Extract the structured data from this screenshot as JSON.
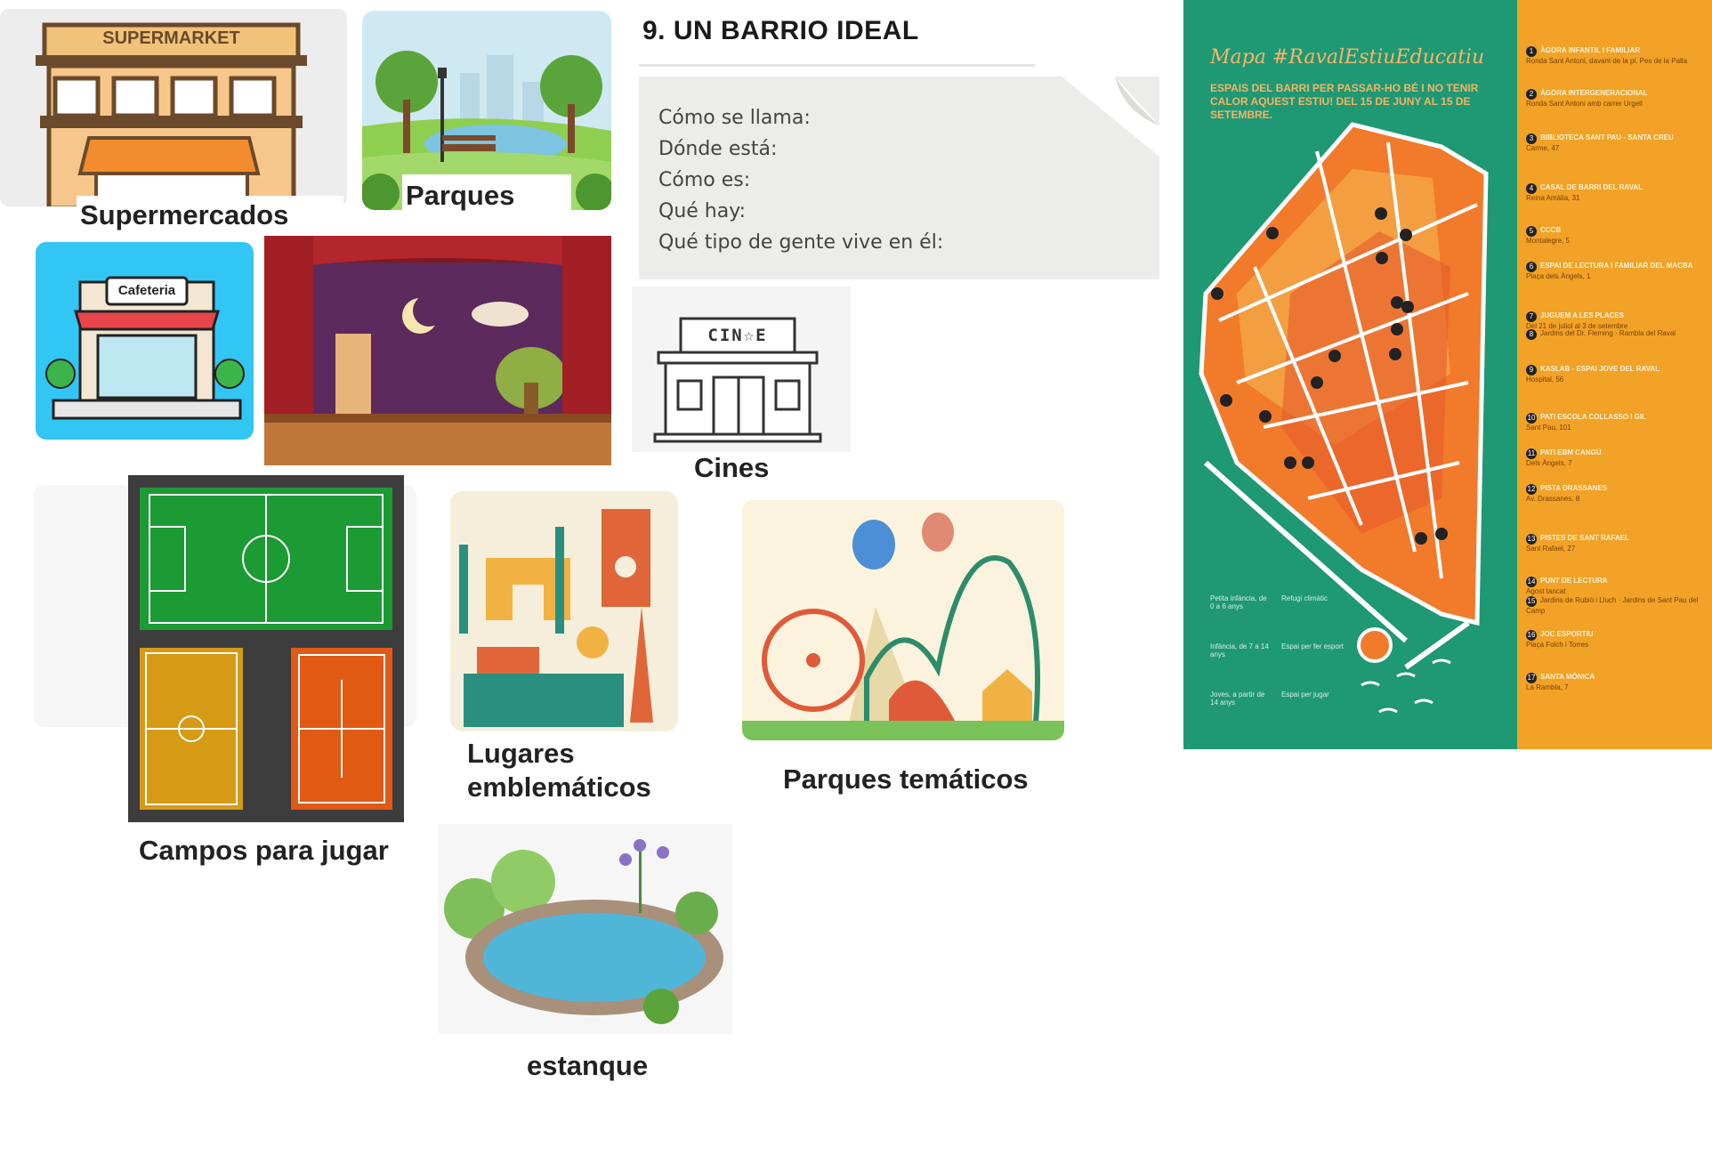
{
  "labels": {
    "supermercados": "Supermercados",
    "parques": "Parques",
    "cines": "Cines",
    "campos": "Campos para jugar",
    "lugares_line1": "Lugares",
    "lugares_line2": "emblemáticos",
    "tematicos": "Parques temáticos",
    "estanque": "estanque"
  },
  "image_text": {
    "supermarket_sign": "SUPERMARKET",
    "cafeteria_sign": "Cafeteria",
    "cinema_sign": "CIN☆E"
  },
  "worksheet": {
    "title": "9. UN BARRIO IDEAL",
    "questions": [
      "Cómo se llama:",
      "Dónde está:",
      "Cómo es:",
      "Qué hay:",
      "Qué tipo de gente vive en él:"
    ]
  },
  "map": {
    "title": "Mapa #RavalEstiuEducatiu",
    "subtitle": "ESPAIS DEL BARRI PER PASSAR-HO BÉ I NO TENIR CALOR AQUEST ESTIU! DEL 15 DE JUNY AL 15 DE SETEMBRE.",
    "legend": [
      {
        "num": "1",
        "name": "ÀGORA INFANTIL I FAMILIAR",
        "detail": "Ronda Sant Antoni, davant de la pl. Pes de la Palla"
      },
      {
        "num": "2",
        "name": "ÀGORA INTERGENERACIONAL",
        "detail": "Ronda Sant Antoni amb carrer Urgell"
      },
      {
        "num": "3",
        "name": "BIBLIOTECA SANT PAU - SANTA CREU",
        "detail": "Carme, 47"
      },
      {
        "num": "4",
        "name": "CASAL DE BARRI DEL RAVAL",
        "detail": "Reina Amàlia, 31"
      },
      {
        "num": "5",
        "name": "CCCB",
        "detail": "Montalegre, 5"
      },
      {
        "num": "6",
        "name": "ESPAI DE LECTURA I FAMILIAR DEL MACBA",
        "detail": "Plaça dels Àngels, 1"
      },
      {
        "num": "7",
        "name": "JUGUEM A LES PLACES",
        "detail": "Del 21 de juliol al 3 de setembre"
      },
      {
        "num": "8",
        "name": "",
        "detail": "Jardins del Dr. Fleming · Rambla del Raval"
      },
      {
        "num": "9",
        "name": "KASLAB - ESPAI JOVE DEL RAVAL",
        "detail": "Hospital, 56"
      },
      {
        "num": "10",
        "name": "PATI ESCOLA COLLASSO I GIL",
        "detail": "Sant Pau, 101"
      },
      {
        "num": "11",
        "name": "PATI EBM CANGÜ",
        "detail": "Dels Àngels, 7"
      },
      {
        "num": "12",
        "name": "PISTA DRASSANES",
        "detail": "Av. Drassanes, 8"
      },
      {
        "num": "13",
        "name": "PISTES DE SANT RAFAEL",
        "detail": "Sant Rafael, 27"
      },
      {
        "num": "14",
        "name": "PUNT DE LECTURA",
        "detail": "Agost tancat"
      },
      {
        "num": "15",
        "name": "",
        "detail": "Jardins de Rubió i Lluch · Jardins de Sant Pau del Camp"
      },
      {
        "num": "16",
        "name": "JOC ESPORTIU",
        "detail": "Plaça Folch i Torres"
      },
      {
        "num": "17",
        "name": "SANTA MÒNICA",
        "detail": "La Rambla, 7"
      }
    ],
    "key": [
      {
        "text": "Petita infància, de 0 a 6 anys"
      },
      {
        "text": "Refugi climàtic"
      },
      {
        "text": "Infància, de 7 a 14 anys"
      },
      {
        "text": "Espai per fer esport"
      },
      {
        "text": "Joves, a partir de 14 anys"
      },
      {
        "text": "Espai per jugar"
      }
    ]
  },
  "colors": {
    "map_green": "#1f9874",
    "map_orange": "#f2a227",
    "cafeteria_bg": "#32c6f4",
    "stage_curtain": "#b3262c",
    "field_green": "#1c9a33",
    "court_orange": "#e05a14",
    "court_yellow": "#d69a14"
  }
}
